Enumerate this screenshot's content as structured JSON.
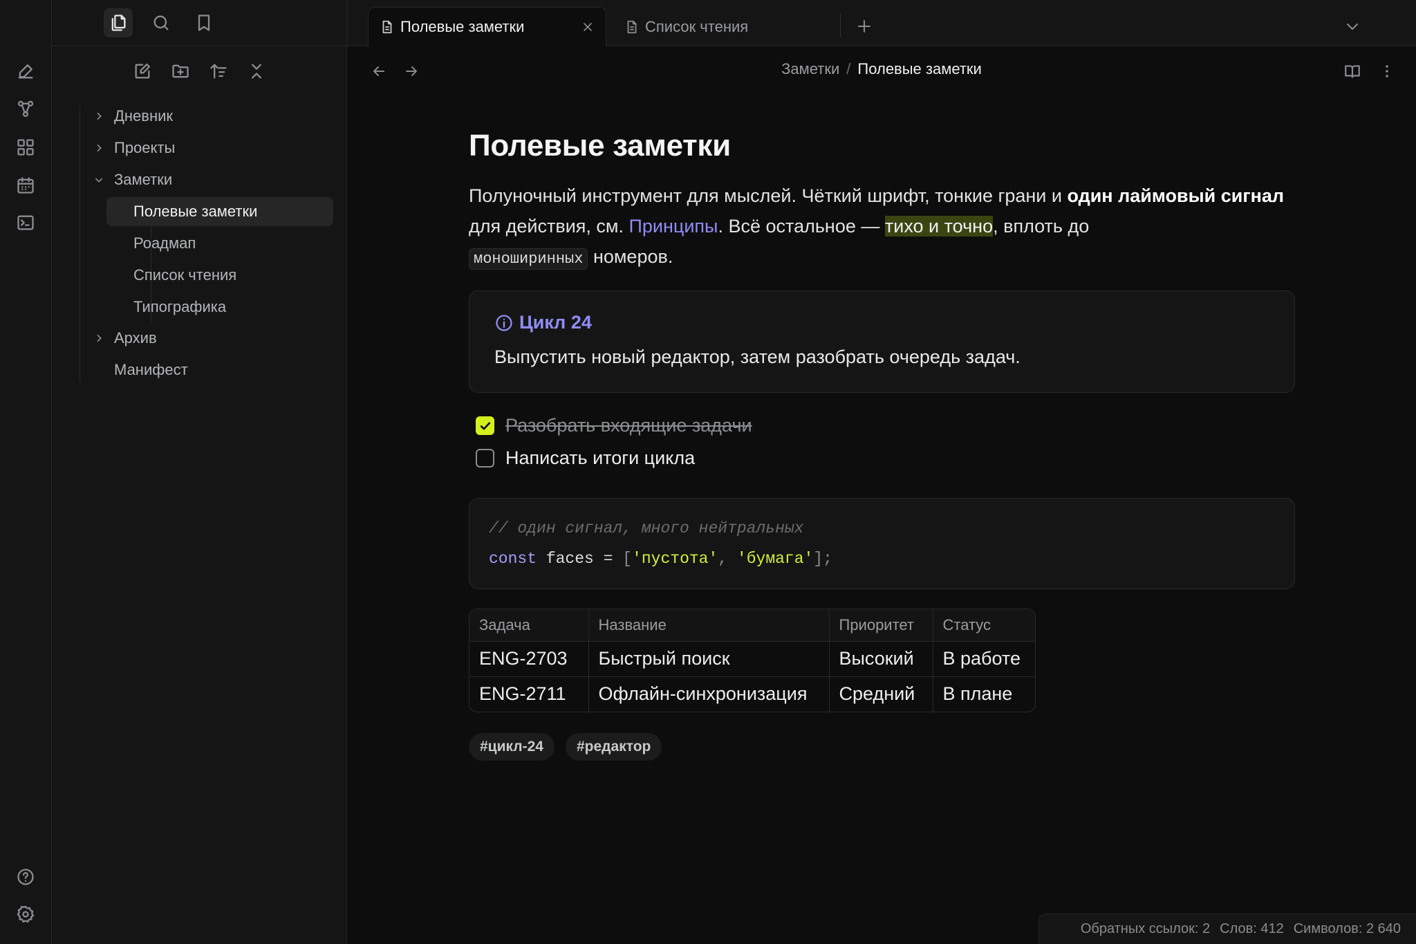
{
  "ribbon": {
    "top_icons": [
      "new-note-icon",
      "graph-view-icon",
      "canvas-icon",
      "daily-notes-icon",
      "command-palette-icon"
    ],
    "bottom_icons": [
      "help-icon",
      "settings-icon"
    ]
  },
  "sidebar": {
    "tabs": [
      "files-icon",
      "search-icon",
      "bookmarks-icon"
    ],
    "actions": [
      "new-note-icon",
      "new-folder-icon",
      "sort-icon",
      "collapse-all-icon"
    ],
    "tree": {
      "diary": "Дневник",
      "projects": "Проекты",
      "notes": "Заметки",
      "notes_children": [
        "Полевые заметки",
        "Роадмап",
        "Список чтения",
        "Типографика"
      ],
      "archive": "Архив",
      "manifesto": "Манифест"
    }
  },
  "tabs": {
    "active": "Полевые заметки",
    "inactive": "Список чтения"
  },
  "breadcrumb": {
    "parent": "Заметки",
    "separator": "/",
    "current": "Полевые заметки"
  },
  "note": {
    "title": "Полевые заметки",
    "para": {
      "t1": "Полуночный инструмент для мыслей. Чёткий шрифт, тонкие грани и ",
      "bold": "один лаймовый сигнал",
      "t2": " для действия, см. ",
      "link": "Принципы",
      "t3": ". Всё остальное — ",
      "highlight": "тихо и точно",
      "t4": ", вплоть до ",
      "code": "моноширинных",
      "t5": " номеров."
    },
    "callout": {
      "title": "Цикл 24",
      "body": "Выпустить новый редактор, затем разобрать очередь задач."
    },
    "tasks": [
      {
        "text": "Разобрать входящие задачи",
        "done": true
      },
      {
        "text": "Написать итоги цикла",
        "done": false
      }
    ],
    "code": {
      "comment": "// один сигнал, много нейтральных",
      "keyword": "const",
      "ident": " faces = ",
      "open": "[",
      "str1": "'пустота'",
      "comma": ", ",
      "str2": "'бумага'",
      "close": "];"
    },
    "table": {
      "headers": [
        "Задача",
        "Название",
        "Приоритет",
        "Статус"
      ],
      "rows": [
        [
          "ENG-2703",
          "Быстрый поиск",
          "Высокий",
          "В работе"
        ],
        [
          "ENG-2711",
          "Офлайн-синхронизация",
          "Средний",
          "В плане"
        ]
      ]
    },
    "tags": [
      "#цикл-24",
      "#редактор"
    ]
  },
  "status": {
    "backlinks": "Обратных ссылок: 2",
    "words": "Слов: 412",
    "chars": "Символов: 2 640"
  },
  "colors": {
    "accent": "#d4ef1e",
    "link": "#8f8cf5",
    "background": "#0d0d0d",
    "panel": "#151515"
  }
}
